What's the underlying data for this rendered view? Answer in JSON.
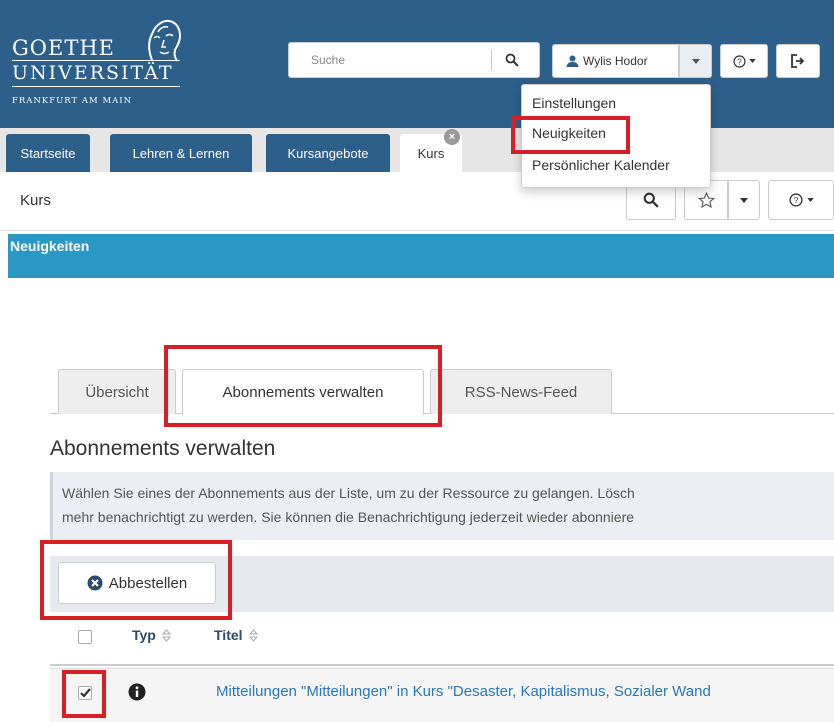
{
  "header": {
    "logo": {
      "line1": "GOETHE",
      "line2": "UNIVERSITÄT",
      "line3": "FRANKFURT AM MAIN"
    },
    "search": {
      "placeholder": "Suche"
    },
    "user_name": "Wylis Hodor"
  },
  "user_menu": {
    "items": [
      "Einstellungen",
      "Neuigkeiten",
      "Persönlicher Kalender"
    ]
  },
  "main_tabs": [
    "Startseite",
    "Lehren & Lernen",
    "Kursangebote",
    "Kurs"
  ],
  "course_title": "Kurs",
  "news_bar": "Neuigkeiten",
  "sub_tabs": [
    "Übersicht",
    "Abonnements verwalten",
    "RSS-News-Feed"
  ],
  "section_heading": "Abonnements verwalten",
  "info_text": {
    "line1": "Wählen Sie eines der Abonnements aus der Liste, um zu der Ressource zu gelangen. Lösch",
    "line2": "mehr benachrichtigt zu werden. Sie können die Benachrichtigung jederzeit wieder abonniere"
  },
  "toolbar": {
    "unsubscribe_label": "Abbestellen"
  },
  "table": {
    "columns": [
      "Typ",
      "Titel"
    ],
    "rows": [
      {
        "checked": true,
        "title": "Mitteilungen \"Mitteilungen\" in Kurs \"Desaster, Kapitalismus, Sozialer Wand"
      }
    ]
  },
  "colors": {
    "header_bg": "#2d5f8b",
    "news_bar_bg": "#2a97c4",
    "highlight": "#d61f26",
    "link": "#2a76b8"
  }
}
